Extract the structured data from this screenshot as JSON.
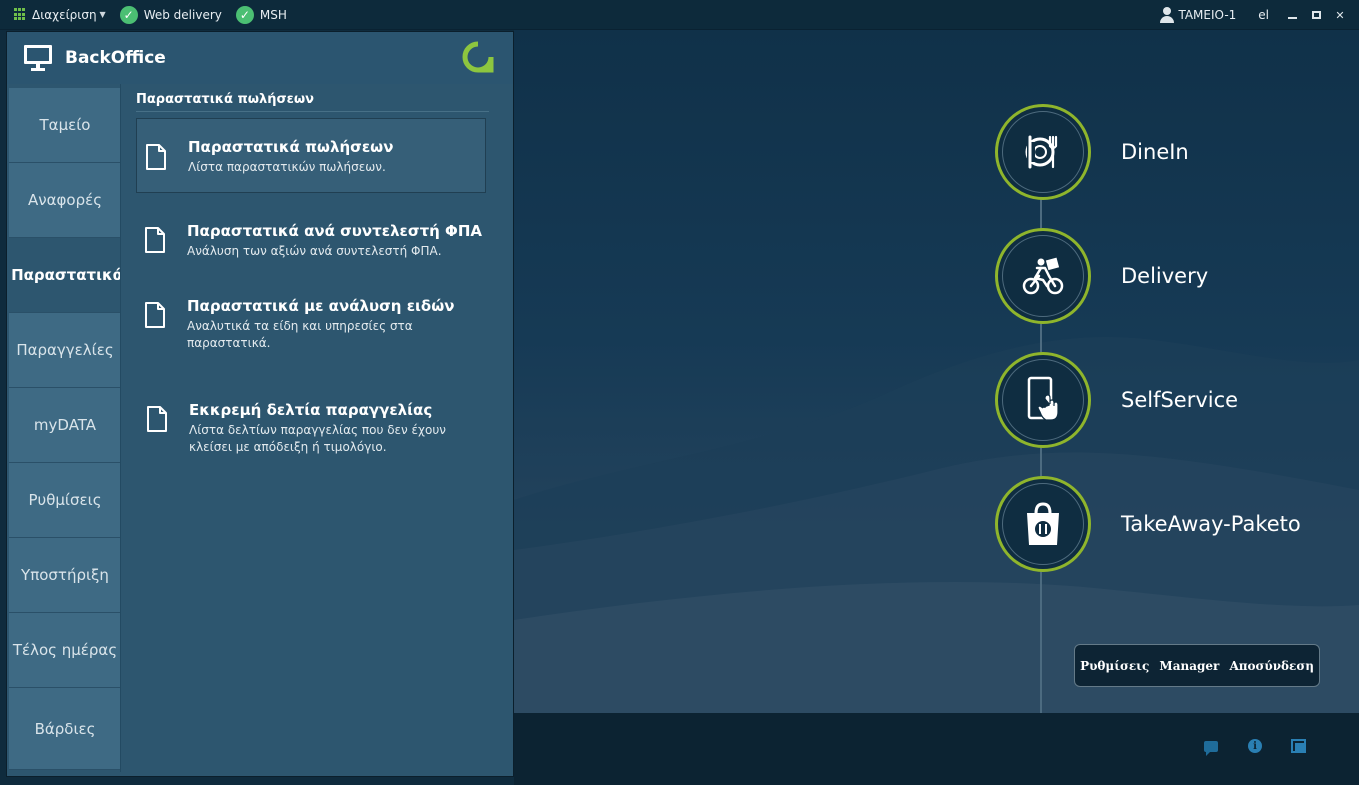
{
  "topbar": {
    "menu_label": "Διαχείριση",
    "status_items": [
      {
        "label": "Web delivery",
        "icon": "check-circle-icon"
      },
      {
        "label": "MSH",
        "icon": "check-circle-icon"
      }
    ],
    "user": "TAMEIO-1",
    "language": "el"
  },
  "backoffice": {
    "title": "BackOffice",
    "tabs": [
      {
        "label": "Ταμείο"
      },
      {
        "label": "Αναφορές"
      },
      {
        "label": "Παραστατικά",
        "active": true
      },
      {
        "label": "Παραγγελίες"
      },
      {
        "label": "myDATA"
      },
      {
        "label": "Ρυθμίσεις"
      },
      {
        "label": "Υποστήριξη"
      },
      {
        "label": "Τέλος ημέρας"
      },
      {
        "label": "Βάρδιες"
      }
    ],
    "section_heading": "Παραστατικά πωλήσεων",
    "items": [
      {
        "title": "Παραστατικά πωλήσεων",
        "desc": "Λίστα παραστατικών πωλήσεων.",
        "selected": true
      },
      {
        "title": "Παραστατικά ανά συντελεστή ΦΠΑ",
        "desc": "Ανάλυση των αξιών ανά συντελεστή ΦΠΑ."
      },
      {
        "title": "Παραστατικά με ανάλυση ειδών",
        "desc": "Αναλυτικά τα είδη και υπηρεσίες στα παραστατικά."
      },
      {
        "title": "Εκκρεμή δελτία παραγγελίας",
        "desc": "Λίστα δελτίων παραγγελίας που δεν έχουν κλείσει με απόδειξη ή τιμολόγιο."
      }
    ]
  },
  "services": [
    {
      "label": "DineIn",
      "icon": "cutlery-icon"
    },
    {
      "label": "Delivery",
      "icon": "delivery-bike-icon"
    },
    {
      "label": "SelfService",
      "icon": "touch-kiosk-icon"
    },
    {
      "label": "TakeAway-Paketo",
      "icon": "takeaway-bag-icon"
    }
  ],
  "actions": {
    "settings": "Ρυθμίσεις",
    "manager": "Manager",
    "logout": "Αποσύνδεση"
  },
  "colors": {
    "accent_ring": "#8fb52c",
    "status_ok": "#4bbf73",
    "panel_bg": "#2d566f"
  }
}
